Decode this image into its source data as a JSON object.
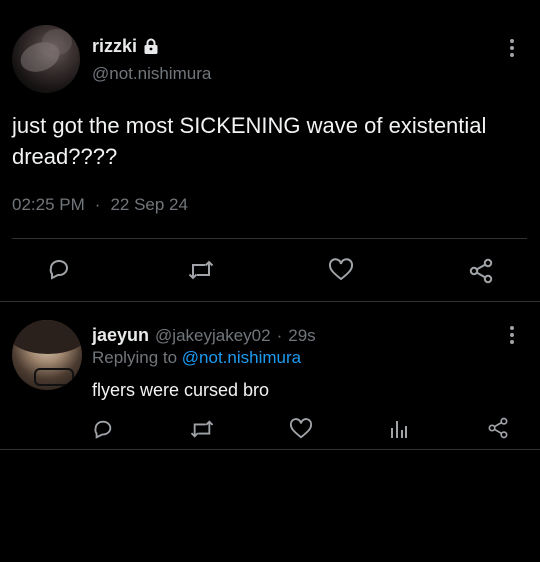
{
  "main_tweet": {
    "display_name": "rizzki",
    "handle": "@not.nishimura",
    "text": "just got the most SICKENING wave of existential dread????",
    "time": "02:25 PM",
    "separator": "·",
    "date": "22 Sep 24"
  },
  "reply": {
    "display_name": "jaeyun",
    "handle": "@jakeyjakey02",
    "separator": "·",
    "age": "29s",
    "replying_to_label": "Replying to",
    "replying_to_handle": "@not.nishimura",
    "text": "flyers were cursed bro"
  },
  "icons": {
    "lock": "lock-icon",
    "more": "more-vertical-icon",
    "reply": "reply-icon",
    "retweet": "retweet-icon",
    "like": "heart-icon",
    "views": "analytics-icon",
    "share": "share-icon"
  },
  "colors": {
    "background": "#000000",
    "text": "#e7e9ea",
    "secondary": "#71767b",
    "link": "#1d9bf0",
    "divider": "#2f3336"
  }
}
